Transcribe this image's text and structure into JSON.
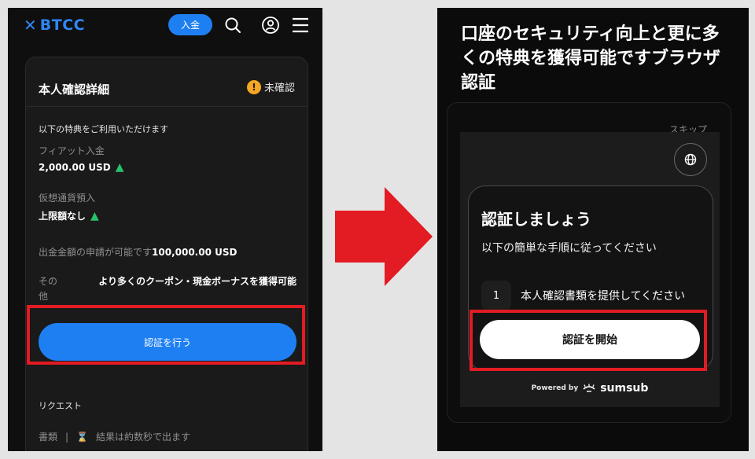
{
  "left": {
    "header": {
      "logo_symbol": "✕",
      "logo_text": "BTCC",
      "deposit_label": "入金"
    },
    "card": {
      "title": "本人確認詳細",
      "status": "未確認",
      "status_icon": "warning-icon",
      "benefits_heading": "以下の特典をご利用いただけます",
      "benefits": [
        {
          "label": "フィアット入金",
          "value": "2,000.00 USD"
        },
        {
          "label": "仮想通貨預入",
          "value": "上限額なし"
        }
      ],
      "withdraw_label": "出金金額の申請が可能です",
      "withdraw_value": "100,000.00 USD",
      "other_label": "その他",
      "other_value": "より多くのクーポン・現金ボーナスを獲得可能",
      "verify_button": "認証を行う",
      "request_label": "リクエスト",
      "request_doc": "書類",
      "request_separator": "|",
      "request_result": "結果は約数秒で出ます"
    }
  },
  "right": {
    "promo_text": "口座のセキュリティ向上と更に多くの特典を獲得可能ですブラウザ認証",
    "skip_label": "スキップ",
    "title": "認証しましょう",
    "description": "以下の簡単な手順に従ってください",
    "step_number": "1",
    "step_text": "本人確認書類を提供してください",
    "start_button": "認証を開始",
    "powered_by": "Powered by",
    "brand": "sumsub"
  },
  "colors": {
    "accent_blue": "#1e7ff2",
    "highlight_red": "#e31b23",
    "up_green": "#27c26b",
    "warning_orange": "#f5a623"
  }
}
